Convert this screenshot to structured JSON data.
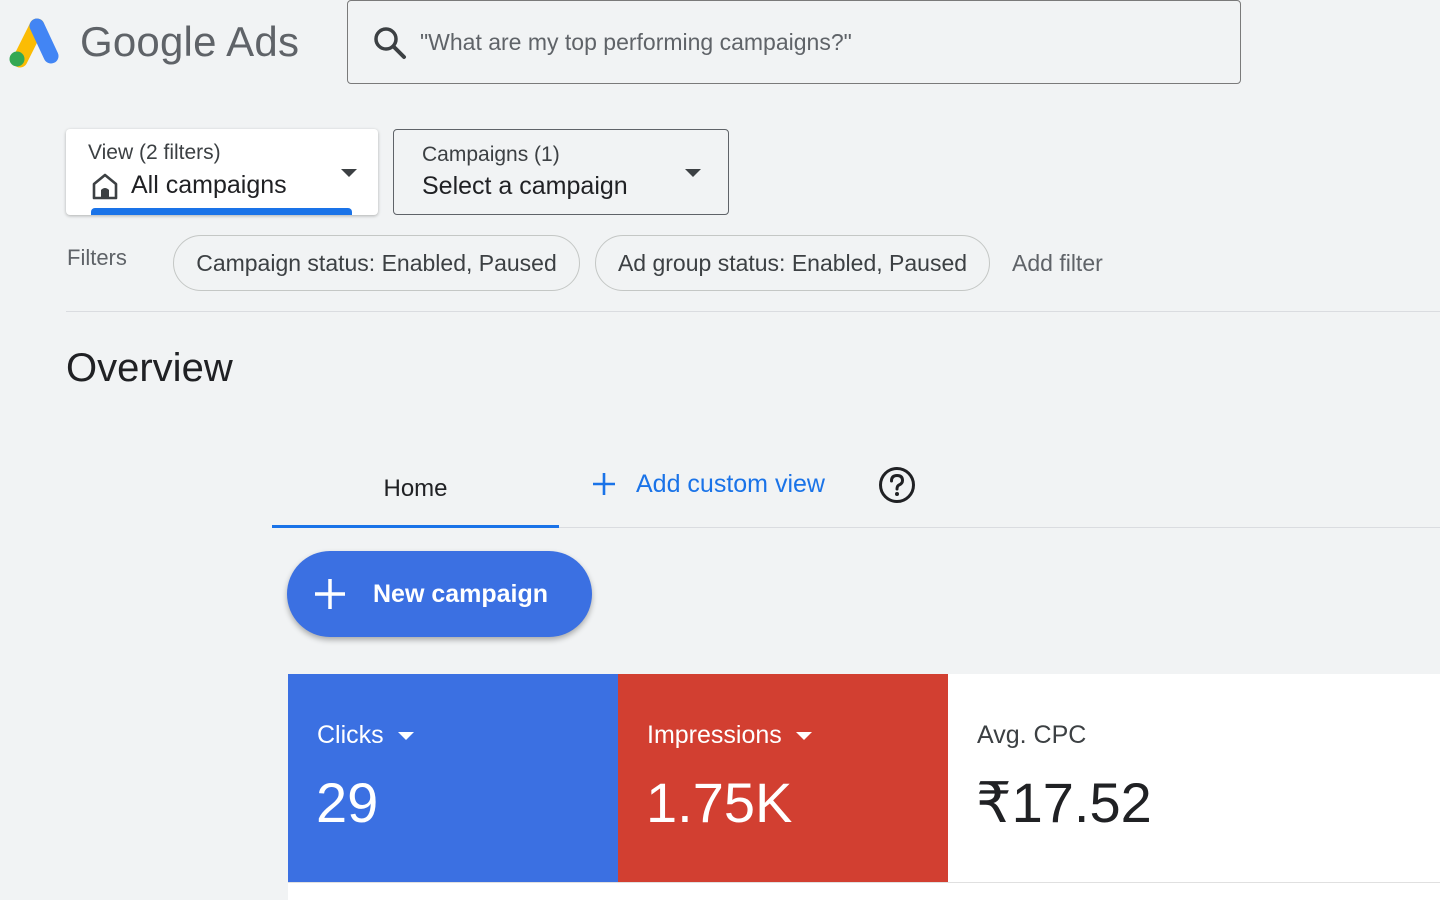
{
  "header": {
    "logo_text": "Google Ads",
    "search_placeholder": "\"What are my top performing campaigns?\""
  },
  "view_selector": {
    "label": "View (2 filters)",
    "value": "All campaigns"
  },
  "campaign_selector": {
    "label": "Campaigns (1)",
    "value": "Select a campaign"
  },
  "filters": {
    "label": "Filters",
    "chips": [
      "Campaign status: Enabled, Paused",
      "Ad group status: Enabled, Paused"
    ],
    "add_label": "Add filter"
  },
  "overview": {
    "title": "Overview"
  },
  "tabs": {
    "home": "Home",
    "add_custom_view": "Add custom view"
  },
  "new_campaign_label": "New campaign",
  "metrics": [
    {
      "name": "Clicks",
      "value": "29"
    },
    {
      "name": "Impressions",
      "value": "1.75K"
    },
    {
      "name": "Avg. CPC",
      "value": "₹17.52"
    }
  ],
  "colors": {
    "accent_blue": "#1a73e8",
    "clicks_blue": "#3b70e2",
    "impressions_red": "#d23f31"
  }
}
